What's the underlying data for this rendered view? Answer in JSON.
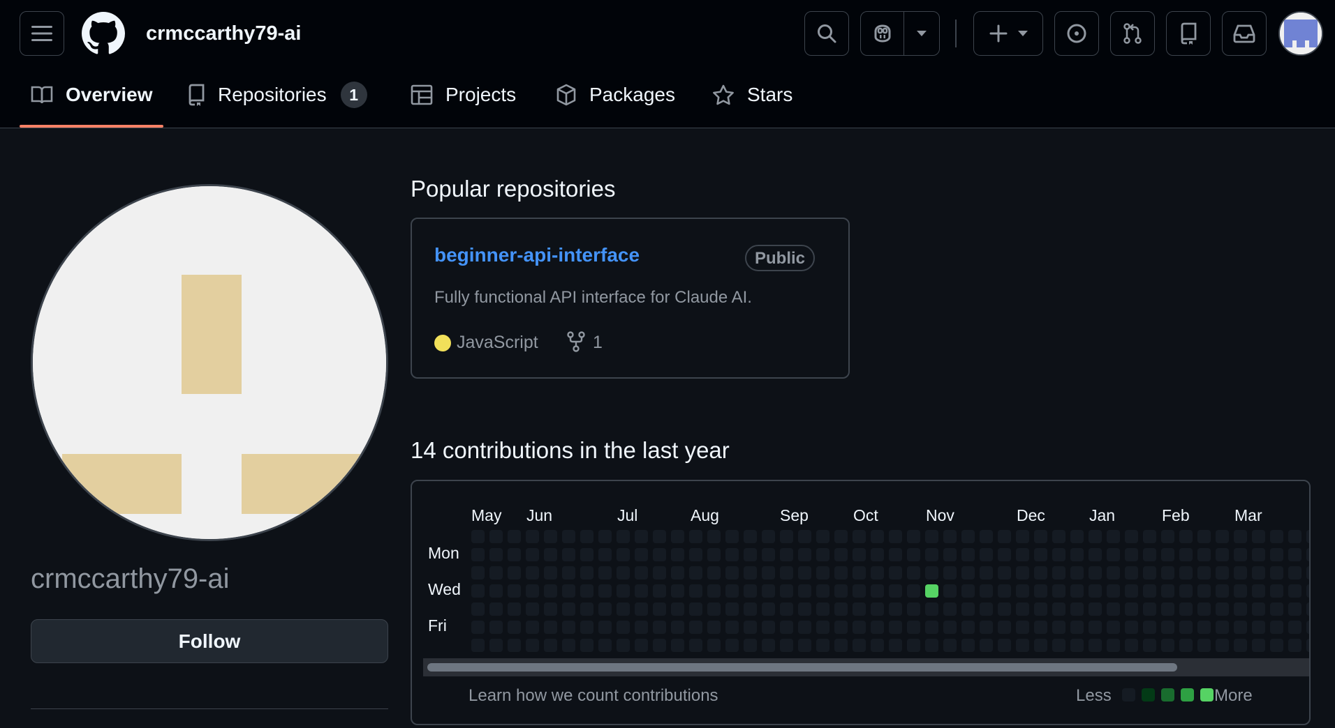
{
  "header": {
    "username": "crmccarthy79-ai",
    "icons": [
      "hamburger-icon",
      "github-logo",
      "search-icon",
      "copilot-icon",
      "chevron-down-icon",
      "plus-icon",
      "issues-icon",
      "pull-requests-icon",
      "repo-icon",
      "inbox-icon"
    ]
  },
  "tabs": [
    {
      "label": "Overview",
      "icon": "book-icon",
      "selected": true
    },
    {
      "label": "Repositories",
      "icon": "repo-icon",
      "counter": "1"
    },
    {
      "label": "Projects",
      "icon": "table-icon"
    },
    {
      "label": "Packages",
      "icon": "package-icon"
    },
    {
      "label": "Stars",
      "icon": "star-icon"
    }
  ],
  "profile": {
    "name": "crmccarthy79-ai",
    "follow_label": "Follow"
  },
  "popular": {
    "title": "Popular repositories",
    "repo": {
      "name": "beginner-api-interface",
      "visibility": "Public",
      "description": "Fully functional API interface for Claude AI.",
      "language": "JavaScript",
      "language_color": "#f1e05a",
      "forks": "1"
    }
  },
  "contributions": {
    "title": "14 contributions in the last year",
    "months": [
      "May",
      "Jun",
      "Jul",
      "Aug",
      "Sep",
      "Oct",
      "Nov",
      "Dec",
      "Jan",
      "Feb",
      "Mar"
    ],
    "days": [
      "Mon",
      "Wed",
      "Fri"
    ],
    "active_cell": {
      "week": 25,
      "day": 3,
      "level": 2
    },
    "learn_link": "Learn how we count contributions",
    "legend_less": "Less",
    "legend_more": "More",
    "legend_colors": [
      "#151b23",
      "#033a16",
      "#196c2e",
      "#2ea043",
      "#56d364"
    ]
  },
  "colors": {
    "accent_underline": "#f78166",
    "link": "#4493f8",
    "avatar_pattern": "#e3cf9f"
  }
}
